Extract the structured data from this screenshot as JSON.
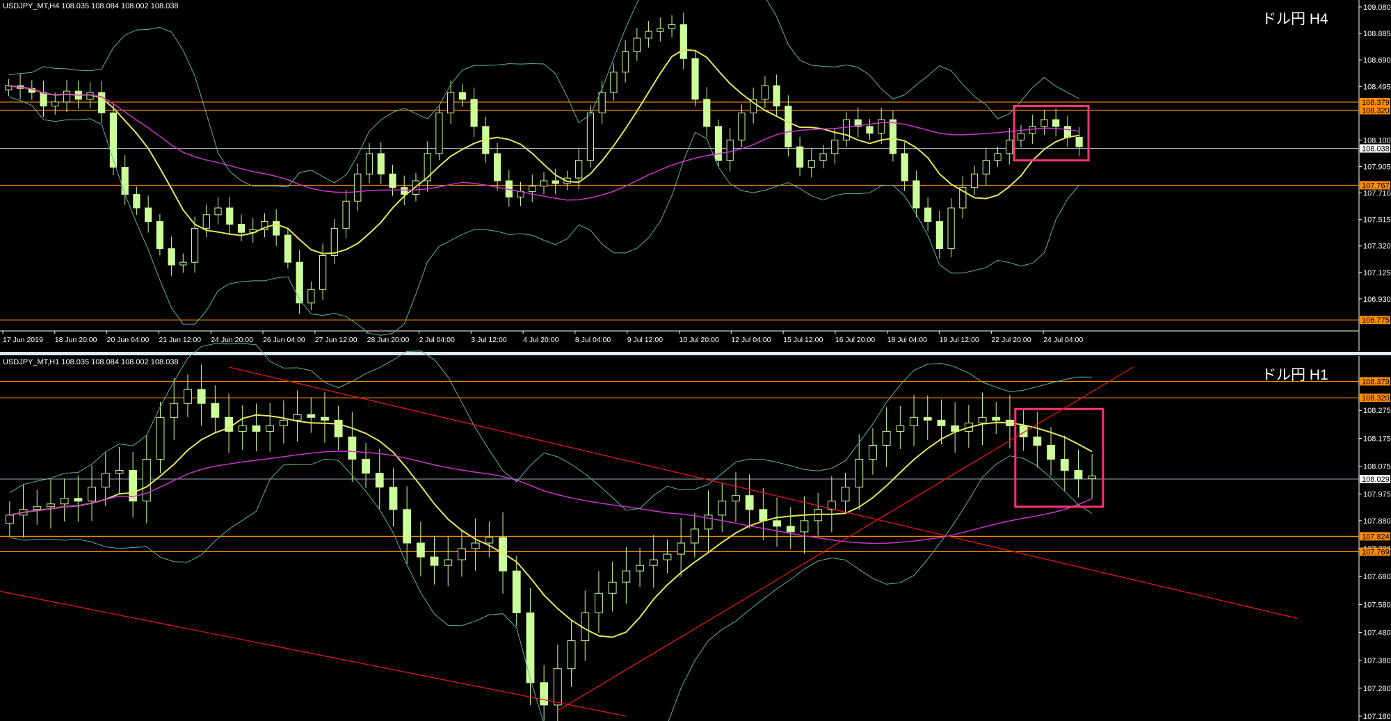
{
  "colors": {
    "background": "#000000",
    "candle": "#ccff99",
    "ma_fast": "#e6e65c",
    "ma_slow": "#cc33cc",
    "bollinger": "#5fb3a3",
    "level_line": "#ff8c00",
    "current_line": "#9aa8b8",
    "trendline": "#e01818",
    "highlight_box": "#ff3377",
    "separator": "#dce8f4"
  },
  "top_panel": {
    "info": "USDJPY_MT,H4  108.035 108.084 108.002 108.038",
    "label": "ドル円 H4",
    "ylim": [
      106.735,
      109.08
    ]
  },
  "bottom_panel": {
    "info": "USDJPY_MT,H1  108.035 108.084 108.002 108.038",
    "label": "ドル円 H1",
    "ylim": [
      107.18,
      108.43
    ]
  },
  "chart_data": [
    {
      "type": "line",
      "title": "ドル円 H4",
      "symbol": "USDJPY_MT,H4",
      "ohlc_last": {
        "open": 108.035,
        "high": 108.084,
        "low": 108.002,
        "close": 108.038
      },
      "ylim": [
        106.735,
        109.08
      ],
      "y_ticks": [
        "109.080",
        "108.885",
        "108.690",
        "108.495",
        "108.100",
        "107.905",
        "107.710",
        "107.515",
        "107.320",
        "107.125",
        "106.930"
      ],
      "x_ticks": [
        "17 Jun 2019",
        "18 Jun 20:00",
        "20 Jun 04:00",
        "21 Jun 12:00",
        "24 Jun 20:00",
        "26 Jun 04:00",
        "27 Jun 12:00",
        "28 Jun 20:00",
        "2 Jul 04:00",
        "3 Jul 12:00",
        "4 Jul 20:00",
        "8 Jul 04:00",
        "9 Jul 12:00",
        "10 Jul 20:00",
        "12 Jul 04:00",
        "15 Jul 12:00",
        "16 Jul 20:00",
        "18 Jul 04:00",
        "19 Jul 12:00",
        "22 Jul 20:00",
        "24 Jul 04:00"
      ],
      "price_levels": [
        "108.379",
        "108.320",
        "107.767",
        "106.775"
      ],
      "current_price": "108.038",
      "closes": [
        108.5,
        108.48,
        108.45,
        108.35,
        108.38,
        108.46,
        108.4,
        108.45,
        108.3,
        107.9,
        107.7,
        107.6,
        107.5,
        107.3,
        107.18,
        107.2,
        107.45,
        107.55,
        107.6,
        107.48,
        107.42,
        107.44,
        107.5,
        107.4,
        107.2,
        106.9,
        107.0,
        107.25,
        107.45,
        107.65,
        107.85,
        108.0,
        107.85,
        107.75,
        107.7,
        107.8,
        108.0,
        108.3,
        108.45,
        108.4,
        108.2,
        108.0,
        107.8,
        107.68,
        107.72,
        107.76,
        107.8,
        107.78,
        107.82,
        107.95,
        108.3,
        108.45,
        108.6,
        108.75,
        108.85,
        108.9,
        108.92,
        108.95,
        108.7,
        108.4,
        108.2,
        107.95,
        108.1,
        108.3,
        108.4,
        108.5,
        108.35,
        108.05,
        107.9,
        107.95,
        108.0,
        108.1,
        108.25,
        108.2,
        108.15,
        108.25,
        108.0,
        107.8,
        107.6,
        107.5,
        107.3,
        107.6,
        107.75,
        107.85,
        107.95,
        108.0,
        108.1,
        108.15,
        108.2,
        108.25,
        108.2,
        108.12,
        108.05
      ]
    },
    {
      "type": "line",
      "title": "ドル円 H1",
      "symbol": "USDJPY_MT,H1",
      "ohlc_last": {
        "open": 108.035,
        "high": 108.084,
        "low": 108.002,
        "close": 108.038
      },
      "ylim": [
        107.18,
        108.43
      ],
      "y_ticks": [
        "108.275",
        "108.175",
        "108.075",
        "107.975",
        "107.880",
        "107.780",
        "107.680",
        "107.580",
        "107.480",
        "107.380",
        "107.280",
        "107.180"
      ],
      "price_levels": [
        "108.379",
        "108.320",
        "107.824",
        "107.769"
      ],
      "current_price": "108.029",
      "closes": [
        107.9,
        107.92,
        107.93,
        107.94,
        107.96,
        107.95,
        108.0,
        108.05,
        108.06,
        107.95,
        108.1,
        108.25,
        108.3,
        108.35,
        108.3,
        108.25,
        108.2,
        108.22,
        108.2,
        108.22,
        108.24,
        108.26,
        108.25,
        108.24,
        108.18,
        108.1,
        108.05,
        108.0,
        107.92,
        107.8,
        107.75,
        107.72,
        107.74,
        107.78,
        107.8,
        107.82,
        107.7,
        107.55,
        107.3,
        107.22,
        107.35,
        107.45,
        107.55,
        107.62,
        107.66,
        107.7,
        107.72,
        107.74,
        107.76,
        107.8,
        107.85,
        107.9,
        107.95,
        107.97,
        107.92,
        107.88,
        107.86,
        107.84,
        107.88,
        107.92,
        107.95,
        108.0,
        108.1,
        108.15,
        108.2,
        108.22,
        108.25,
        108.24,
        108.22,
        108.2,
        108.23,
        108.25,
        108.24,
        108.22,
        108.18,
        108.15,
        108.1,
        108.06,
        108.03,
        108.04
      ]
    }
  ]
}
